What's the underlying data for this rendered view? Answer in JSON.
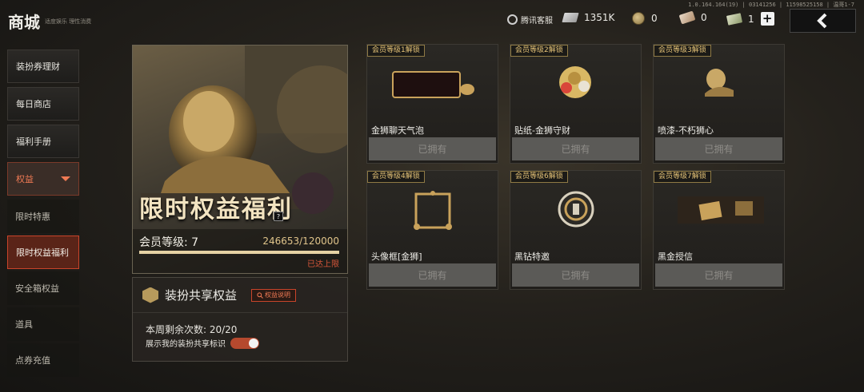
{
  "version_text": "1.0.164.164(19) | 03141256 | 115985251​58 | 温哥1-7",
  "header": {
    "title": "商城",
    "subtitle": "适度娱乐 理性消费",
    "customer_service": "腾讯客服",
    "currencies": [
      {
        "icon": "coupon-icon",
        "value": "1351K"
      },
      {
        "icon": "coin-icon",
        "value": "0"
      },
      {
        "icon": "ticket-icon",
        "value": "0"
      },
      {
        "icon": "cash-icon",
        "value": "1"
      }
    ],
    "plus": "+"
  },
  "sidebar": {
    "top_items": [
      "装扮券理财",
      "每日商店",
      "福利手册"
    ],
    "expanded": "权益",
    "sub_items": [
      "限时特惠",
      "限时权益福利",
      "安全箱权益",
      "道具",
      "点券充值"
    ],
    "active_sub": "限时权益福利"
  },
  "hero": {
    "title": "限时权益福利",
    "help": "?",
    "level_label": "会员等级: 7",
    "exp_text": "246653/120000",
    "progress": 1.0,
    "status": "已达上限"
  },
  "share": {
    "title": "装扮共享权益",
    "explain_button": "权益说明",
    "remaining": "本周剩余次数: 20/20",
    "show_label": "展示我的装扮共享标识",
    "toggle_on": true
  },
  "rewards": [
    {
      "badge": "会员等级1解锁",
      "name": "金狮聊天气泡",
      "status": "已拥有"
    },
    {
      "badge": "会员等级2解锁",
      "name": "贴纸-金狮守财",
      "status": "已拥有"
    },
    {
      "badge": "会员等级3解锁",
      "name": "喷漆-不朽狮心",
      "status": "已拥有"
    },
    {
      "badge": "会员等级4解锁",
      "name": "头像框[金狮]",
      "status": "已拥有"
    },
    {
      "badge": "会员等级6解锁",
      "name": "黑钻特邀",
      "status": "已拥有"
    },
    {
      "badge": "会员等级7解锁",
      "name": "黑金授信",
      "status": "已拥有"
    }
  ]
}
